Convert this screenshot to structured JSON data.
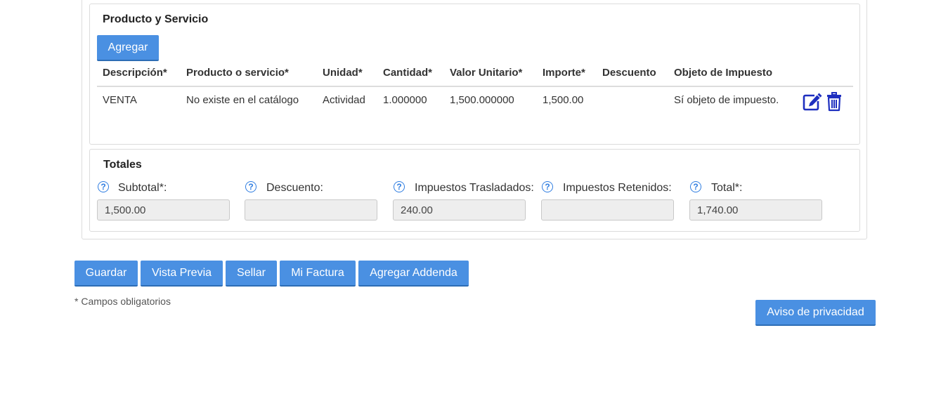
{
  "products": {
    "title": "Producto y Servicio",
    "add_button": "Agregar",
    "columns": [
      "Descripción*",
      "Producto o servicio*",
      "Unidad*",
      "Cantidad*",
      "Valor Unitario*",
      "Importe*",
      "Descuento",
      "Objeto de Impuesto"
    ],
    "rows": [
      {
        "descripcion": "VENTA",
        "producto": "No existe en el catálogo",
        "unidad": "Actividad",
        "cantidad": "1.000000",
        "valor_unitario": "1,500.000000",
        "importe": "1,500.00",
        "descuento": "",
        "objeto_impuesto": "Sí objeto de impuesto.",
        "actions": [
          "edit-icon",
          "trash-icon"
        ]
      }
    ]
  },
  "totals": {
    "title": "Totales",
    "help_icon": "question-circle-icon",
    "fields": [
      {
        "label": "Subtotal*:",
        "value": "1,500.00"
      },
      {
        "label": "Descuento:",
        "value": ""
      },
      {
        "label": "Impuestos Trasladados:",
        "value": "240.00"
      },
      {
        "label": "Impuestos Retenidos:",
        "value": ""
      },
      {
        "label": "Total*:",
        "value": "1,740.00"
      }
    ]
  },
  "actions": {
    "guardar": "Guardar",
    "vista_previa": "Vista Previa",
    "sellar": "Sellar",
    "mi_factura": "Mi Factura",
    "agregar_addenda": "Agregar Addenda"
  },
  "required_note": "* Campos obligatorios",
  "privacy_button": "Aviso de privacidad",
  "colors": {
    "button_bg": "#4a90e2",
    "icon_blue": "#1e2fbf",
    "help_blue": "#2f7de1",
    "input_bg": "#eeeeee"
  }
}
